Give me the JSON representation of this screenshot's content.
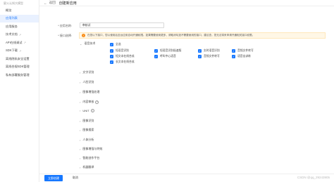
{
  "sidebar": {
    "brand": "星火认知大模型",
    "items": [
      {
        "label": "概览",
        "ext": ""
      },
      {
        "label": "应用列表",
        "ext": ""
      },
      {
        "label": "应用服务",
        "ext": ""
      },
      {
        "label": "技术文档",
        "ext": "↗"
      },
      {
        "label": "API在线调试",
        "ext": "↗"
      },
      {
        "label": "SDK下载",
        "ext": "↗"
      },
      {
        "label": "离线隐私安全设置",
        "ext": ""
      },
      {
        "label": "离线合规SDK管理",
        "ext": ""
      },
      {
        "label": "私有部署服务管理",
        "ext": ""
      }
    ]
  },
  "topbar": {
    "back_icon": "←",
    "back_label": "返回",
    "title": "创建新应用"
  },
  "form": {
    "name_label": "* 应用名称:",
    "name_value": "审核试",
    "api_label": "* 接口选择:",
    "notice": "在您以下接口，您以使用后至台应用自动开通权限。如果需要使用更多，请取消勾选不需要使用的接口，建议查，您无法将来申请开通相关接口权限。"
  },
  "groups": [
    {
      "label": "语音技术",
      "expanded": true,
      "help": false
    },
    {
      "label": "文字识别",
      "expanded": false,
      "help": false
    },
    {
      "label": "人脸识别",
      "expanded": false,
      "help": false
    },
    {
      "label": "图像增强处理",
      "expanded": false,
      "help": false
    },
    {
      "label": "内容审核",
      "expanded": false,
      "help": true
    },
    {
      "label": "UNIT",
      "expanded": false,
      "help": true
    },
    {
      "label": "图像识别",
      "expanded": false,
      "help": false
    },
    {
      "label": "图像搜索",
      "expanded": false,
      "help": false
    },
    {
      "label": "人体分析",
      "expanded": false,
      "help": false
    },
    {
      "label": "图像增强与特效",
      "expanded": false,
      "help": false
    },
    {
      "label": "智能创作平台",
      "expanded": false,
      "help": false
    },
    {
      "label": "机器翻译",
      "expanded": false,
      "help": false
    }
  ],
  "checkboxes": {
    "all": "全选",
    "col1": [
      "短语音识别",
      "短文本在线合成",
      "长文本在线合成"
    ],
    "col2": [
      "短语音识别极速版",
      "呼叫中心语音"
    ],
    "col3": [
      "实时语音识别",
      "音频文件转写"
    ],
    "col4": [
      "音频文件转写",
      "语音自训练"
    ]
  },
  "footer": {
    "confirm": "立即创建",
    "cancel": "取消",
    "watermark": "CSDN @qq_29243905"
  },
  "colors": {
    "primary": "#1677ff",
    "notice_bg": "#fff7e6",
    "warn": "#fa8c16"
  }
}
